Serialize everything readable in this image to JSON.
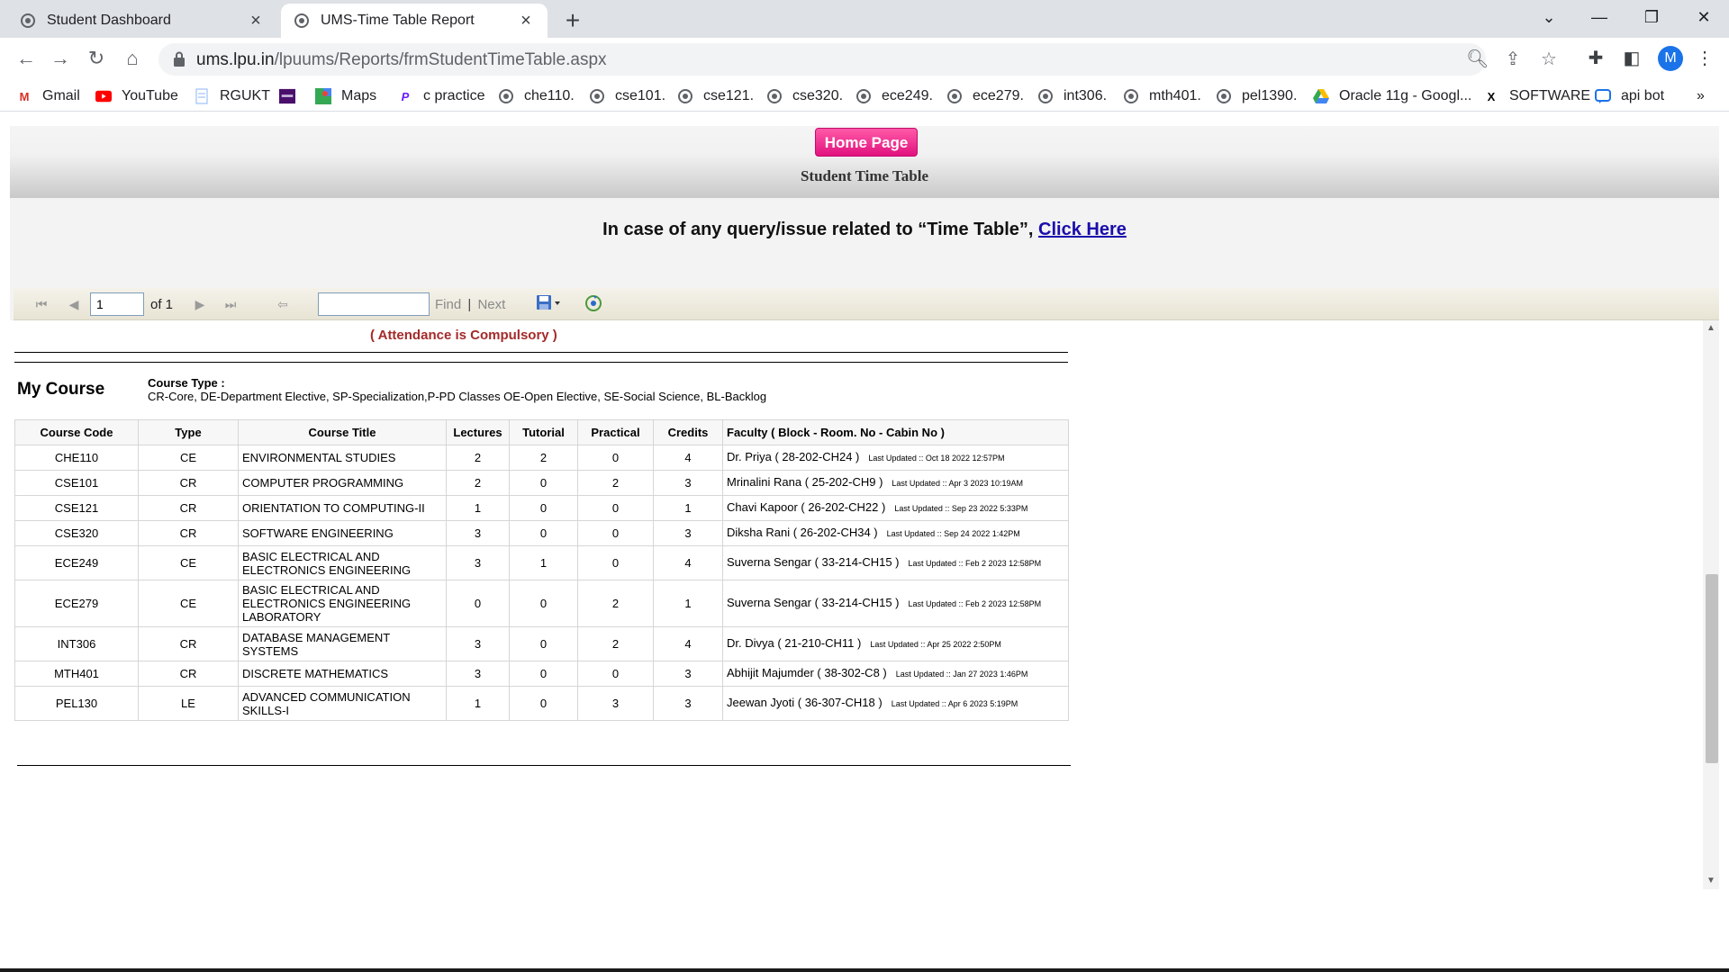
{
  "browser": {
    "tabs": [
      {
        "title": "Student Dashboard",
        "active": false
      },
      {
        "title": "UMS-Time Table Report",
        "active": true
      }
    ],
    "url_host": "ums.lpu.in",
    "url_path": "/lpuums/Reports/frmStudentTimeTable.aspx",
    "profile_initial": "M",
    "bookmarks": [
      "Gmail",
      "YouTube",
      "RGUKT",
      "",
      "Maps",
      "c practice",
      "che110.",
      "cse101.",
      "cse121.",
      "cse320.",
      "ece249.",
      "ece279.",
      "int306.",
      "mth401.",
      "pel1390.",
      "Oracle 11g - Googl...",
      "SOFTWARE",
      "api bot"
    ],
    "bookmark_overflow": "»"
  },
  "page": {
    "home_button": "Home Page",
    "title": "Student Time Table",
    "query_text": "In case of any query/issue related to “Time Table”,",
    "query_link": "Click Here"
  },
  "report_toolbar": {
    "page_number": "1",
    "of_text": "of 1",
    "find_placeholder": "",
    "find_label": "Find",
    "separator": "|",
    "next_label": "Next"
  },
  "report": {
    "attendance_note": "( Attendance is Compulsory )",
    "section_title": "My Course",
    "course_type_label": "Course Type :",
    "course_type_desc": "CR-Core, DE-Department Elective, SP-Specialization,P-PD Classes OE-Open Elective, SE-Social Science, BL-Backlog",
    "columns": [
      "Course Code",
      "Type",
      "Course Title",
      "Lectures",
      "Tutorial",
      "Practical",
      "Credits",
      "Faculty ( Block - Room. No - Cabin No )"
    ],
    "rows": [
      {
        "code": "CHE110",
        "type": "CE",
        "title": "ENVIRONMENTAL STUDIES",
        "lectures": "2",
        "tutorial": "2",
        "practical": "0",
        "credits": "4",
        "faculty": "Dr. Priya ( 28-202-CH24 )",
        "updated": "Last Updated :: Oct 18 2022 12:57PM"
      },
      {
        "code": "CSE101",
        "type": "CR",
        "title": "COMPUTER PROGRAMMING",
        "lectures": "2",
        "tutorial": "0",
        "practical": "2",
        "credits": "3",
        "faculty": "Mrinalini Rana ( 25-202-CH9 )",
        "updated": "Last Updated :: Apr  3 2023 10:19AM"
      },
      {
        "code": "CSE121",
        "type": "CR",
        "title": "ORIENTATION TO COMPUTING-II",
        "lectures": "1",
        "tutorial": "0",
        "practical": "0",
        "credits": "1",
        "faculty": "Chavi Kapoor ( 26-202-CH22 )",
        "updated": "Last Updated :: Sep 23 2022  5:33PM"
      },
      {
        "code": "CSE320",
        "type": "CR",
        "title": "SOFTWARE ENGINEERING",
        "lectures": "3",
        "tutorial": "0",
        "practical": "0",
        "credits": "3",
        "faculty": "Diksha Rani ( 26-202-CH34 )",
        "updated": "Last Updated :: Sep 24 2022  1:42PM"
      },
      {
        "code": "ECE249",
        "type": "CE",
        "title": "BASIC ELECTRICAL AND ELECTRONICS ENGINEERING",
        "lectures": "3",
        "tutorial": "1",
        "practical": "0",
        "credits": "4",
        "faculty": "Suverna Sengar ( 33-214-CH15 )",
        "updated": "Last Updated :: Feb  2 2023 12:58PM"
      },
      {
        "code": "ECE279",
        "type": "CE",
        "title": "BASIC ELECTRICAL AND ELECTRONICS ENGINEERING LABORATORY",
        "lectures": "0",
        "tutorial": "0",
        "practical": "2",
        "credits": "1",
        "faculty": "Suverna Sengar ( 33-214-CH15 )",
        "updated": "Last Updated :: Feb  2 2023 12:58PM"
      },
      {
        "code": "INT306",
        "type": "CR",
        "title": "DATABASE MANAGEMENT SYSTEMS",
        "lectures": "3",
        "tutorial": "0",
        "practical": "2",
        "credits": "4",
        "faculty": "Dr. Divya ( 21-210-CH11 )",
        "updated": "Last Updated :: Apr 25 2022  2:50PM"
      },
      {
        "code": "MTH401",
        "type": "CR",
        "title": "DISCRETE MATHEMATICS",
        "lectures": "3",
        "tutorial": "0",
        "practical": "0",
        "credits": "3",
        "faculty": "Abhijit Majumder ( 38-302-C8 )",
        "updated": "Last Updated :: Jan 27 2023  1:46PM"
      },
      {
        "code": "PEL130",
        "type": "LE",
        "title": "ADVANCED COMMUNICATION SKILLS-I",
        "lectures": "1",
        "tutorial": "0",
        "practical": "3",
        "credits": "3",
        "faculty": "Jeewan Jyoti ( 36-307-CH18 )",
        "updated": "Last Updated :: Apr  6 2023  5:19PM"
      }
    ]
  },
  "colors": {
    "home_button": "#e2127f",
    "attendance": "#a52a2a",
    "link": "#1a0dab",
    "profile": "#1a73e8"
  }
}
